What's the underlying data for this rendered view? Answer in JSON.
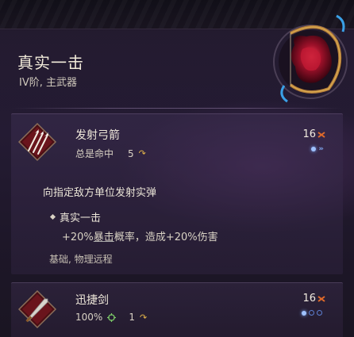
{
  "item": {
    "name": "真实一击",
    "subtitle": "IV阶, 主武器"
  },
  "skills": [
    {
      "name": "发射弓箭",
      "meta_text": "总是命中",
      "cost": "5",
      "level": "16",
      "description": "向指定敌方单位发射实弹",
      "bullet_title": "真实一击",
      "bullet_desc_prefix": "+20%",
      "bullet_desc_keyword": "暴击",
      "bullet_desc_suffix": "概率，造成+20%伤害",
      "tags": "基础, 物理远程"
    },
    {
      "name": "迅捷剑",
      "accuracy": "100%",
      "cost": "1",
      "level": "16"
    }
  ],
  "colors": {
    "gem_active": "#9fc2ff",
    "gem_inactive": "#5d7fd1",
    "arrow_gold": "#e3b44a",
    "level_marker": "#e06a2a"
  },
  "icons": {
    "weapon_emblem": "crimson-bow-icon",
    "skill1_icon": "arrow-volley-icon",
    "skill2_icon": "sword-icon",
    "cost_icon": "arrow-curve-icon",
    "accuracy_icon": "crosshair-icon"
  }
}
